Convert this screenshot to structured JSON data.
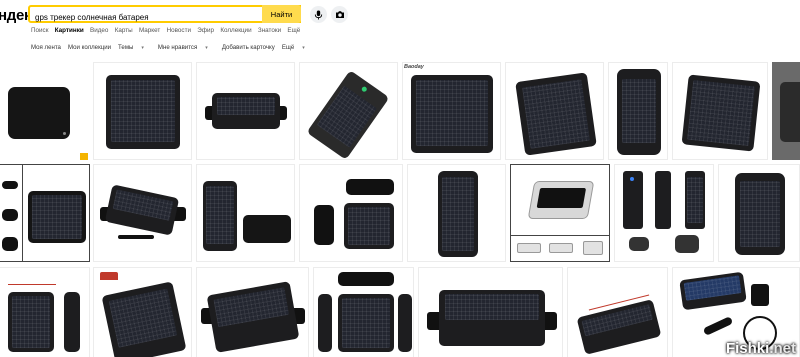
{
  "header": {
    "logo_text": "ндекс",
    "search_value": "gps трекер солнечная батарея",
    "search_button": "Найти"
  },
  "services": [
    {
      "label": "Поиск",
      "active": false
    },
    {
      "label": "Картинки",
      "active": true
    },
    {
      "label": "Видео",
      "active": false
    },
    {
      "label": "Карты",
      "active": false
    },
    {
      "label": "Маркет",
      "active": false
    },
    {
      "label": "Новости",
      "active": false
    },
    {
      "label": "Эфир",
      "active": false
    },
    {
      "label": "Коллекции",
      "active": false
    },
    {
      "label": "Знатоки",
      "active": false
    },
    {
      "label": "Ещё",
      "active": false
    }
  ],
  "subnav": {
    "my_feed": "Моя лента",
    "my_collections": "Мои коллекции",
    "themes": "Темы",
    "i_like": "Мне нравится",
    "add_card": "Добавить карточку",
    "more": "Ещё"
  },
  "images": {
    "brand_label": "Baoday",
    "watermark": "Fishki",
    "watermark_suffix": ".net"
  },
  "colors": {
    "search_border": "#ffcc00",
    "search_button": "#ffdb4d",
    "device_dark": "#1d1d1f",
    "badge_yellow": "#f4b400"
  },
  "icons": [
    "microphone-icon",
    "camera-icon",
    "caret-down-icon",
    "shopping-cart-icon"
  ]
}
